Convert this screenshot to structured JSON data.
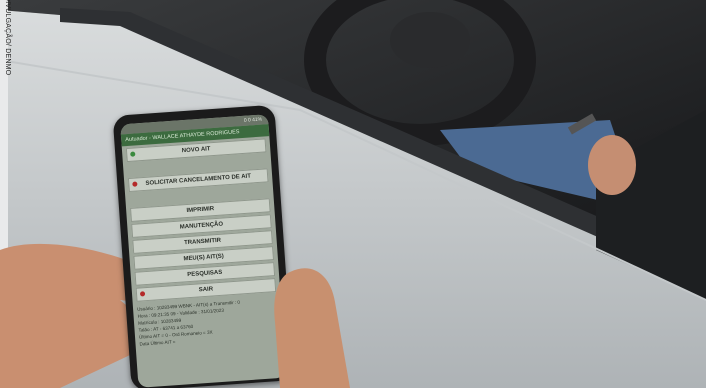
{
  "credit": "DIVULGAÇÃO/ DENMO",
  "phone": {
    "status_bar": "0 0 41%",
    "app_bar": "Autuador - WALLACE ATHAYDE RODRIGUES",
    "menu_items": [
      {
        "label": "NOVO AIT",
        "icon": "plus-icon"
      },
      {
        "label": "SOLICITAR CANCELAMENTO DE AIT",
        "icon": "stop-icon"
      },
      {
        "label": "IMPRIMIR",
        "icon": ""
      },
      {
        "label": "MANUTENÇÃO",
        "icon": ""
      },
      {
        "label": "TRANSMITIR",
        "icon": ""
      },
      {
        "label": "MEU(S) AIT(S)",
        "icon": ""
      },
      {
        "label": "PESQUISAS",
        "icon": ""
      },
      {
        "label": "SAIR",
        "icon": "exit-icon"
      }
    ],
    "info_lines": [
      "Usuário : 10283499 WBNK - AIT(s) a Transmitir : 0",
      "Hora : 09:21:35 09 - Validade : 31/01/2023",
      "Matrícula : 10283499",
      "Talão : AT - 63741 a 63760",
      "Último AIT = 0 - Ord Romaneio = 3X",
      "Data Último AIT ="
    ]
  },
  "colors": {
    "screen": "#9ea79b",
    "appbar": "#3c6b3f",
    "button": "#c9cfc6"
  }
}
